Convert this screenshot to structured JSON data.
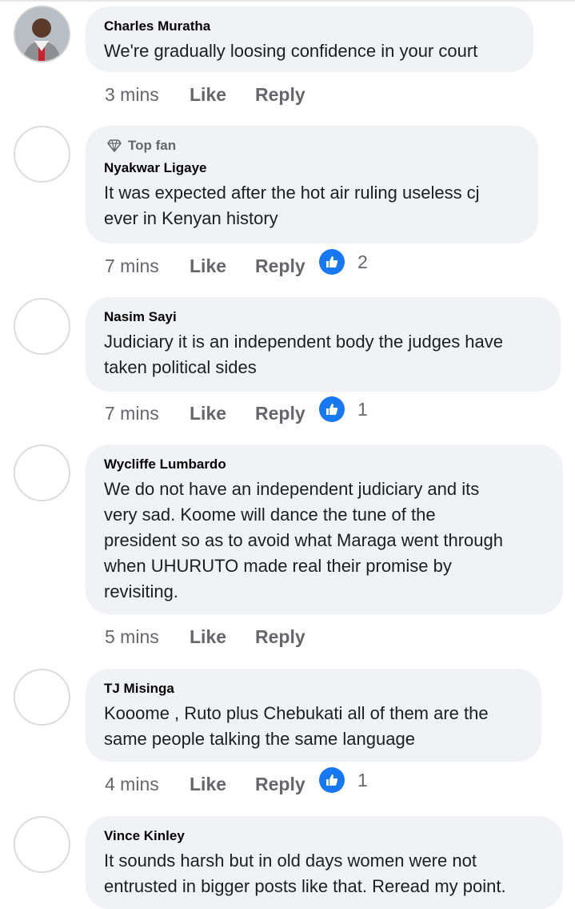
{
  "comments": [
    {
      "author": "Charles Muratha",
      "text": "We're gradually loosing confidence in your court",
      "time": "3 mins",
      "like_label": "Like",
      "reply_label": "Reply",
      "top_fan": "",
      "reactions": ""
    },
    {
      "author": "Nyakwar Ligaye",
      "text": "It was expected after the hot air ruling useless cj\never in Kenyan history",
      "time": "7 mins",
      "like_label": "Like",
      "reply_label": "Reply",
      "top_fan": "Top fan",
      "reactions": "2"
    },
    {
      "author": "Nasim Sayi",
      "text": "Judiciary it is an independent body the judges have\ntaken political sides",
      "time": "7 mins",
      "like_label": "Like",
      "reply_label": "Reply",
      "top_fan": "",
      "reactions": "1"
    },
    {
      "author": "Wycliffe Lumbardo",
      "text": "We do not have an independent judiciary and its\nvery sad. Koome will dance the tune of the\npresident so as to avoid what Maraga went through\nwhen UHURUTO made real their promise by\nrevisiting.",
      "time": "5 mins",
      "like_label": "Like",
      "reply_label": "Reply",
      "top_fan": "",
      "reactions": ""
    },
    {
      "author": "TJ Misinga",
      "text": "Kooome , Ruto plus Chebukati all of them are the\nsame people talking the same language",
      "time": "4 mins",
      "like_label": "Like",
      "reply_label": "Reply",
      "top_fan": "",
      "reactions": "1"
    },
    {
      "author": "Vince Kinley",
      "text": "It sounds harsh but in old days women were not\nentrusted in bigger posts like that. Reread my point.",
      "time": "",
      "like_label": "",
      "reply_label": "",
      "top_fan": "",
      "reactions": ""
    }
  ],
  "colors": {
    "bubble": "#f0f2f5",
    "meta_text": "#65676b",
    "like_blue": "#1877f2"
  },
  "icons": {
    "top_fan": "diamond-icon",
    "reaction": "thumbs-up-icon"
  }
}
